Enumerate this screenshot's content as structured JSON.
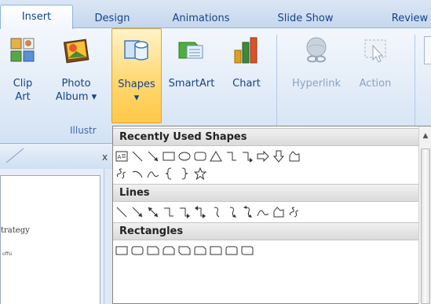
{
  "tabs": [
    {
      "label": "Insert",
      "active": true
    },
    {
      "label": "Design",
      "active": false
    },
    {
      "label": "Animations",
      "active": false
    },
    {
      "label": "Slide Show",
      "active": false
    },
    {
      "label": "Review",
      "active": false
    }
  ],
  "ribbon": {
    "clip_art": {
      "line1": "Clip",
      "line2": "Art"
    },
    "photo_album": {
      "line1": "Photo",
      "line2": "Album ▾"
    },
    "shapes": {
      "line1": "Shapes",
      "line2": "▾"
    },
    "smartart": {
      "line1": "SmartArt"
    },
    "chart": {
      "line1": "Chart"
    },
    "hyperlink": {
      "line1": "Hyperlink"
    },
    "action": {
      "line1": "Action"
    },
    "group_illustrations": "Illustr"
  },
  "slide_pane": {
    "close_glyph": "x",
    "slide_text_1": "trategy",
    "slide_text_2": "offsi"
  },
  "gallery": {
    "sections": [
      {
        "title": "Recently Used Shapes"
      },
      {
        "title": "Lines"
      },
      {
        "title": "Rectangles"
      }
    ],
    "colors": {
      "header_bg": "#dadada",
      "selected_button": "#ffd873"
    }
  }
}
